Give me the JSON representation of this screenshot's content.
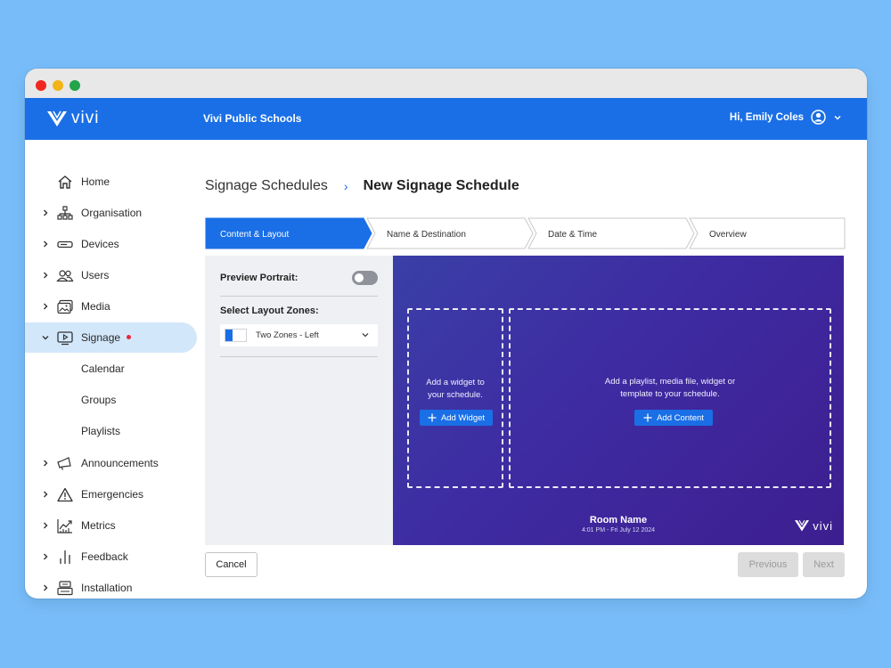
{
  "app": {
    "logo_text": "vivi",
    "org_name": "Vivi Public Schools",
    "greeting": "Hi, Emily Coles"
  },
  "sidebar": {
    "items": [
      {
        "label": "Home"
      },
      {
        "label": "Organisation"
      },
      {
        "label": "Devices"
      },
      {
        "label": "Users"
      },
      {
        "label": "Media"
      },
      {
        "label": "Signage"
      },
      {
        "label": "Calendar"
      },
      {
        "label": "Groups"
      },
      {
        "label": "Playlists"
      },
      {
        "label": "Announcements"
      },
      {
        "label": "Emergencies"
      },
      {
        "label": "Metrics"
      },
      {
        "label": "Feedback"
      },
      {
        "label": "Installation"
      }
    ]
  },
  "breadcrumb": {
    "parent": "Signage Schedules",
    "separator": "›",
    "current": "New Signage Schedule"
  },
  "steps": [
    {
      "label": "Content & Layout",
      "active": true
    },
    {
      "label": "Name & Destination",
      "active": false
    },
    {
      "label": "Date & Time",
      "active": false
    },
    {
      "label": "Overview",
      "active": false
    }
  ],
  "settings": {
    "preview_portrait_label": "Preview Portrait:",
    "preview_portrait_on": false,
    "layout_zones_label": "Select Layout Zones:",
    "layout_zone_value": "Two Zones - Left"
  },
  "preview": {
    "widget_zone_text_1": "Add a widget to",
    "widget_zone_text_2": "your schedule.",
    "add_widget_label": "Add Widget",
    "content_zone_text_1": "Add a playlist, media file, widget or",
    "content_zone_text_2": "template to your schedule.",
    "add_content_label": "Add Content",
    "room_name": "Room Name",
    "room_time": "4:01 PM - Fri July 12 2024",
    "logo_text": "vivi"
  },
  "footer": {
    "cancel_label": "Cancel",
    "previous_label": "Previous",
    "next_label": "Next"
  },
  "colors": {
    "primary": "#1a6fe6",
    "background": "#78bdfa",
    "active_nav": "#d3e7fb",
    "notification": "#e8263a",
    "preview_bg": "#3d2aa0"
  }
}
